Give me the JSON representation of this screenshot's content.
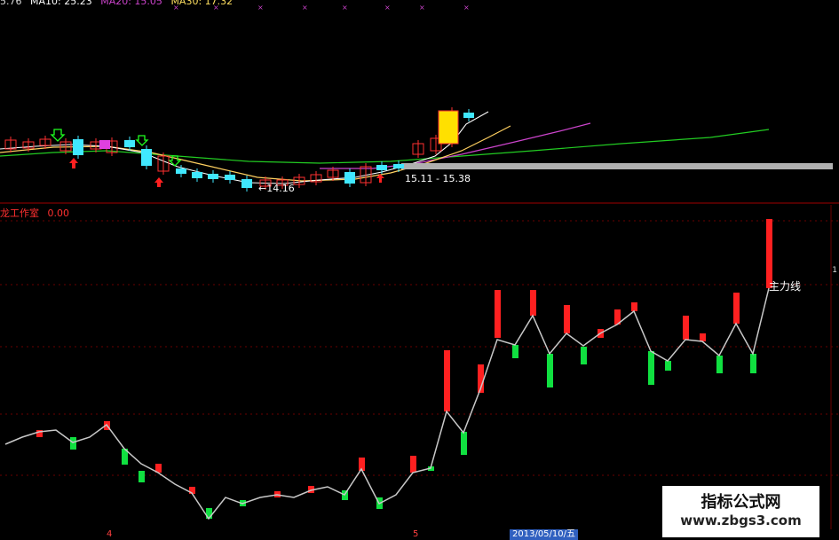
{
  "top_legend": {
    "items": [
      "5.76",
      "MA10: 25.23",
      "MA20: 15.05",
      "MA30: 17.32"
    ],
    "colors": [
      "#dddddd",
      "#ffffff",
      "#cc44cc",
      "#ffe060"
    ]
  },
  "upper_chart": {
    "annotations": {
      "low_label": "←14.16",
      "range_label": "15.11 - 15.38"
    },
    "colors": {
      "up": "#ff3030",
      "down": "#40e8ff",
      "ma5": "#ffffff",
      "ma10": "#ffd060",
      "ma20": "#cc44cc",
      "ma30": "#22cc22",
      "band": "#b0b0b0"
    },
    "up_arrow_color": "#ff2020",
    "down_arrow_color": "#20ff20"
  },
  "indicator": {
    "title": "龙工作室",
    "value": "0.00",
    "line_label": "主力线",
    "colors": {
      "line": "#c8c8c8",
      "up": "#ff2020",
      "down": "#10e040",
      "grid": "#8b0000"
    }
  },
  "x_axis": {
    "labels": [
      "4",
      "5"
    ],
    "date_cursor": "2013/05/10/五"
  },
  "right_scale_mark": "1",
  "watermark": {
    "line1": "指标公式网",
    "line2": "www.zbgs3.com"
  }
}
